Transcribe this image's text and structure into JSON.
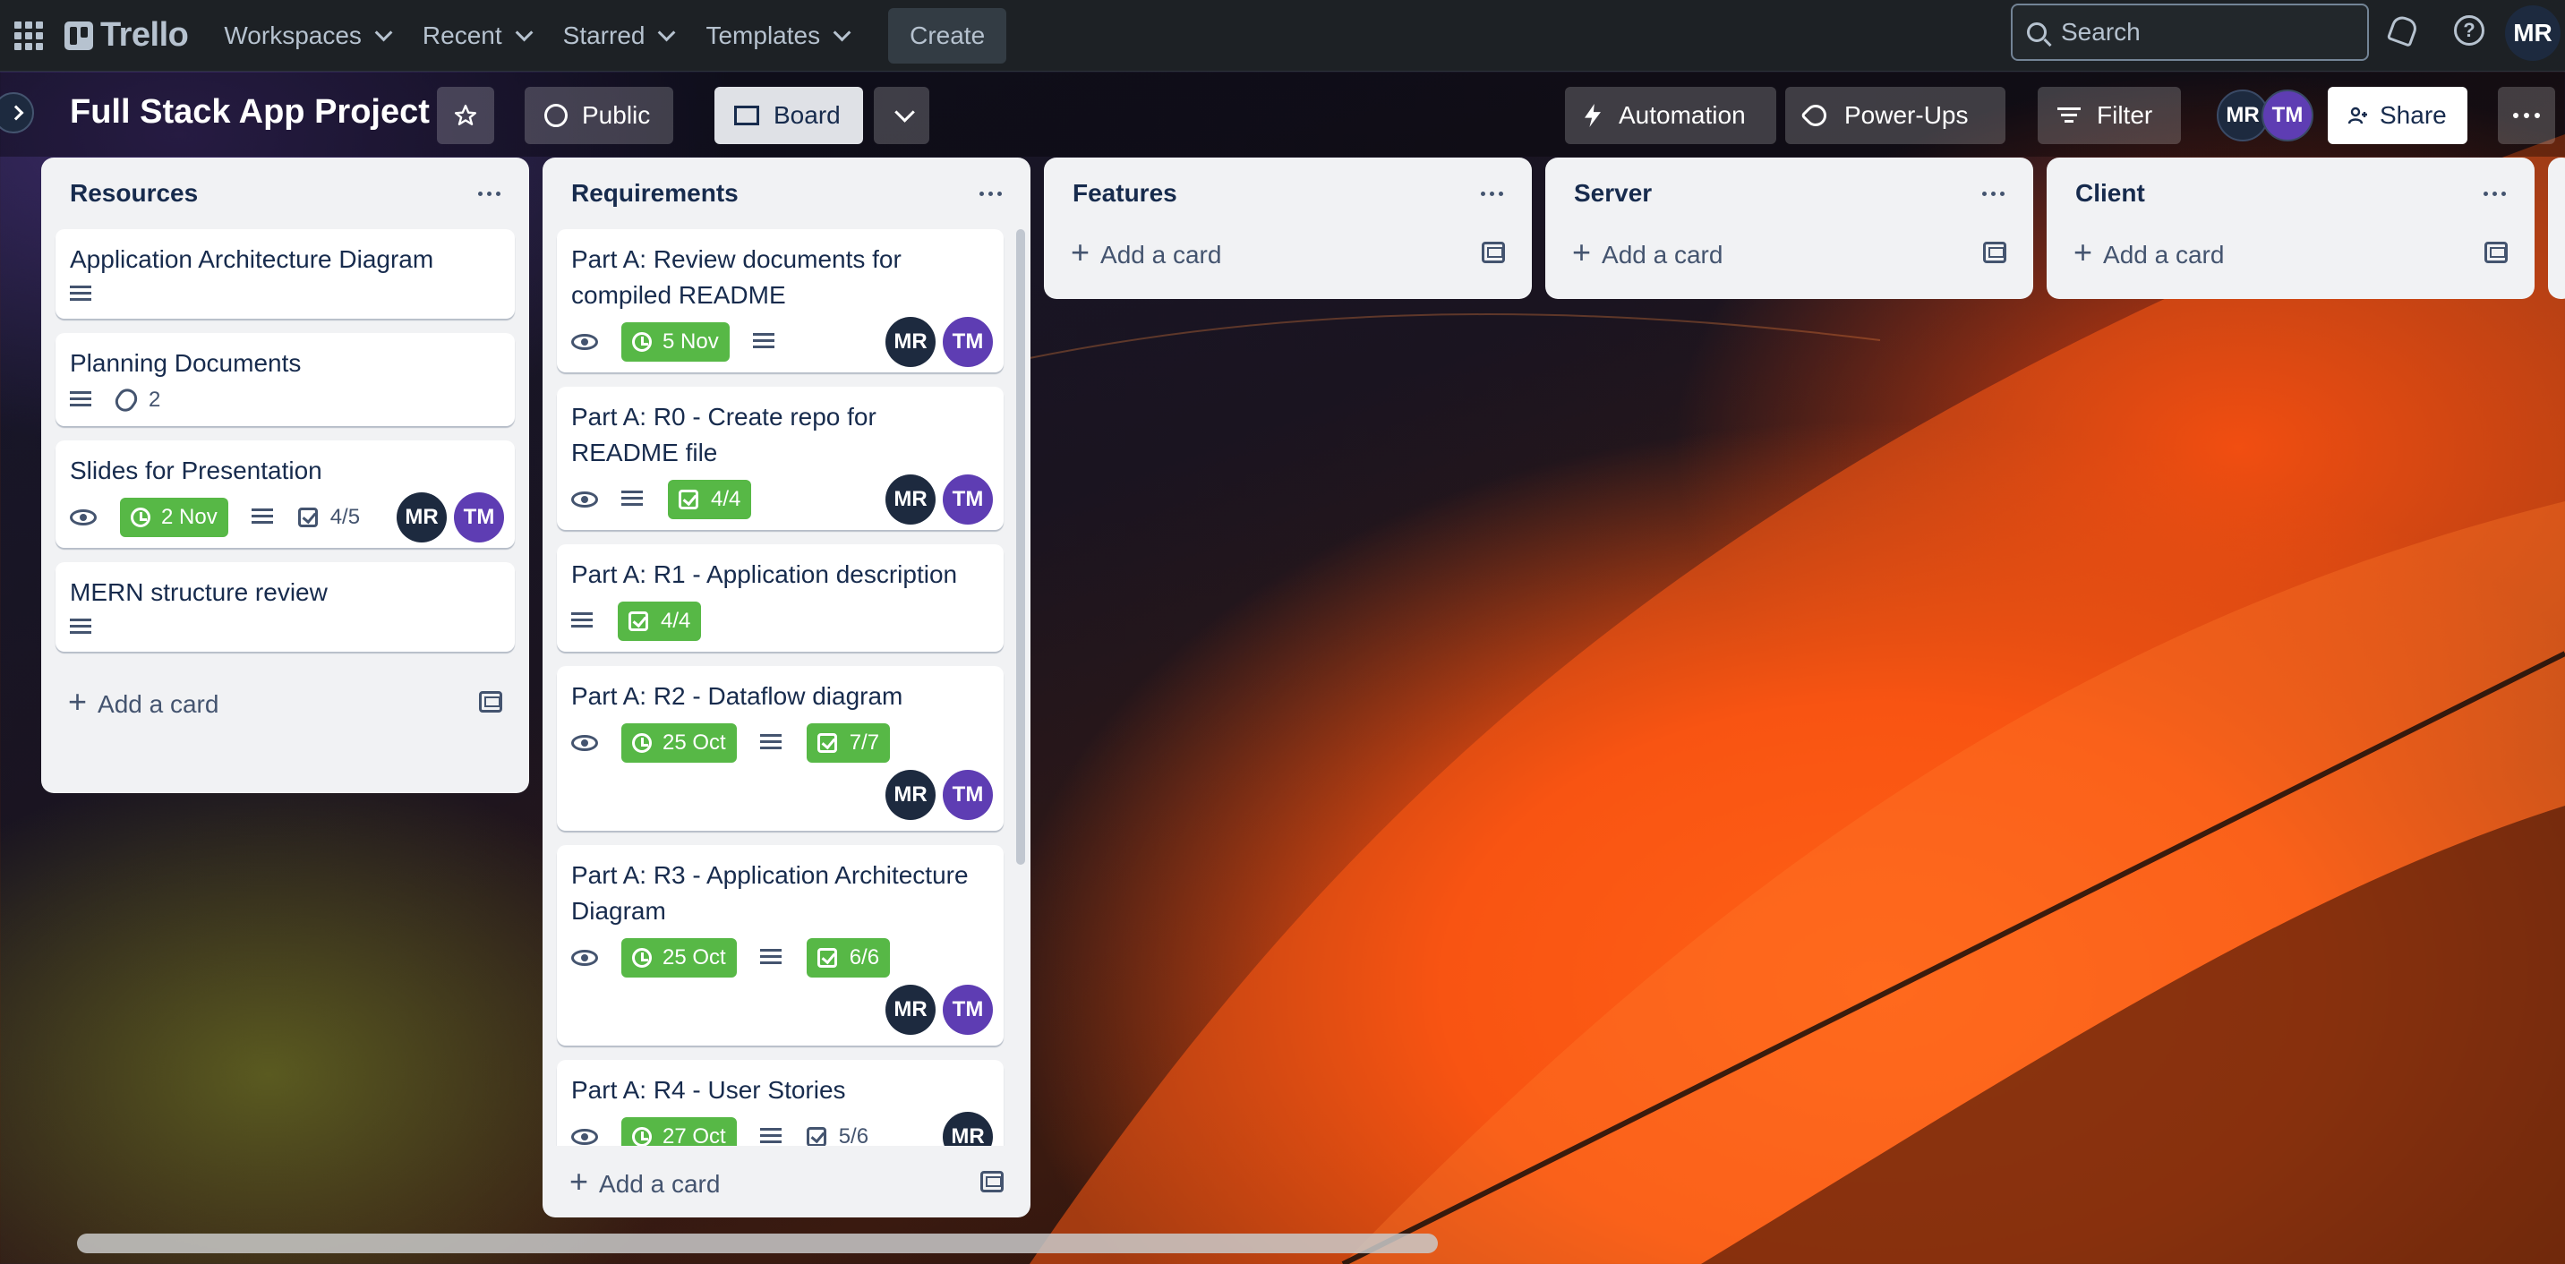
{
  "nav": {
    "brand": "Trello",
    "menus": [
      "Workspaces",
      "Recent",
      "Starred",
      "Templates"
    ],
    "create": "Create",
    "search_placeholder": "Search",
    "user_initials": "MR"
  },
  "board": {
    "title": "Full Stack App Project",
    "visibility": "Public",
    "view": "Board",
    "automation": "Automation",
    "powerups": "Power-Ups",
    "filter": "Filter",
    "share": "Share",
    "members": [
      "MR",
      "TM"
    ]
  },
  "lists": [
    {
      "title": "Resources",
      "cards": [
        {
          "title": "Application Architecture Diagram",
          "desc": true
        },
        {
          "title": "Planning Documents",
          "desc": true,
          "attachments": "2"
        },
        {
          "title": "Slides for Presentation",
          "watch": true,
          "due": "2 Nov",
          "desc": true,
          "checklist": "4/5",
          "members": [
            "MR",
            "TM"
          ]
        },
        {
          "title": "MERN structure review",
          "desc": true
        }
      ],
      "add": "Add a card"
    },
    {
      "title": "Requirements",
      "cards": [
        {
          "title": "Part A: Review documents for compiled README",
          "watch": true,
          "due": "5 Nov",
          "desc": true,
          "members": [
            "MR",
            "TM"
          ]
        },
        {
          "title": "Part A: R0 - Create repo for README file",
          "watch": true,
          "desc": true,
          "checklist": "4/4",
          "members": [
            "MR",
            "TM"
          ]
        },
        {
          "title": "Part A: R1 - Application description",
          "desc": true,
          "checklist": "4/4"
        },
        {
          "title": "Part A: R2 - Dataflow diagram",
          "watch": true,
          "due": "25 Oct",
          "desc": true,
          "checklist": "7/7",
          "members": [
            "MR",
            "TM"
          ]
        },
        {
          "title": "Part A: R3 - Application Architecture Diagram",
          "watch": true,
          "due": "25 Oct",
          "desc": true,
          "checklist": "6/6",
          "members": [
            "MR",
            "TM"
          ]
        },
        {
          "title": "Part A: R4 - User Stories",
          "watch": true,
          "due": "27 Oct",
          "desc": true,
          "checklist": "5/6",
          "members": [
            "MR"
          ]
        }
      ],
      "add": "Add a card"
    },
    {
      "title": "Features",
      "cards": [],
      "add": "Add a card"
    },
    {
      "title": "Server",
      "cards": [],
      "add": "Add a card"
    },
    {
      "title": "Client",
      "cards": [],
      "add": "Add a card"
    }
  ],
  "colors": {
    "nav_bg": "#1d2125",
    "list_bg": "#f1f2f4",
    "badge_green": "#57b846",
    "avatar_mr": "#1d2a3f",
    "avatar_tm": "#5e3db3"
  }
}
